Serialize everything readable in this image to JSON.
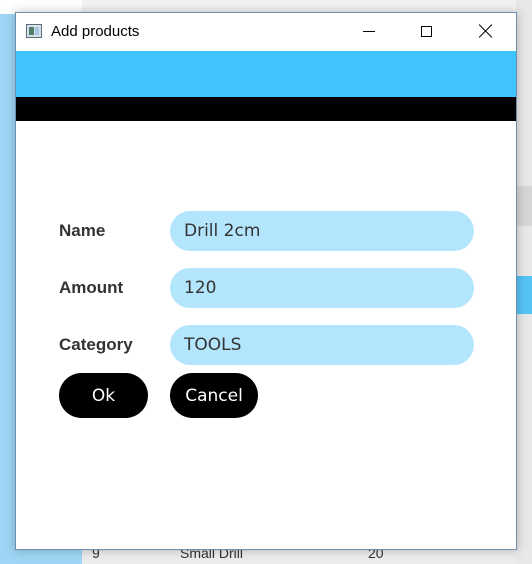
{
  "window": {
    "title": "Add products"
  },
  "form": {
    "name_label": "Name",
    "name_value": "Drill 2cm",
    "amount_label": "Amount",
    "amount_value": "120",
    "category_label": "Category",
    "category_value": "TOOLS"
  },
  "buttons": {
    "ok": "Ok",
    "cancel": "Cancel"
  },
  "background_row": {
    "id": "9",
    "name": "Small Drill",
    "amount": "20"
  },
  "colors": {
    "header": "#40c4ff",
    "band": "#000000",
    "input_bg": "#b3e5fc",
    "button_bg": "#000000",
    "button_text": "#ffffff"
  },
  "icons": [
    "app-icon",
    "minimize-icon",
    "maximize-icon",
    "close-icon"
  ]
}
